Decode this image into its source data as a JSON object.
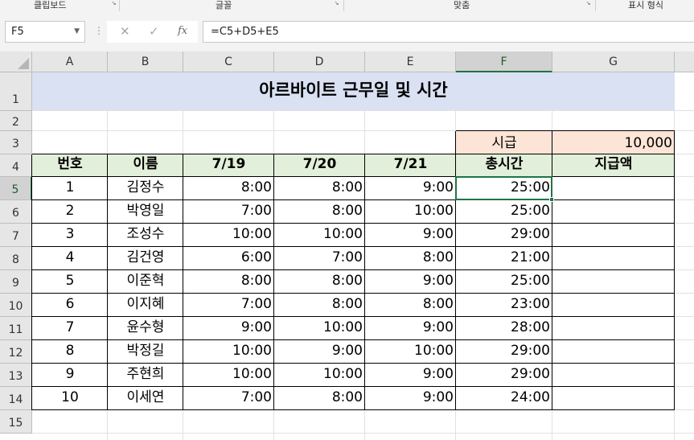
{
  "ribbon_groups": [
    "클립보드",
    "글꼴",
    "맞춤",
    "표시 형식"
  ],
  "name_box": "F5",
  "formula": "=C5+D5+E5",
  "formula_buttons": {
    "cancel": "✕",
    "enter": "✓",
    "function": "fx"
  },
  "columns": [
    "A",
    "B",
    "C",
    "D",
    "E",
    "F",
    "G"
  ],
  "rows": [
    "1",
    "2",
    "3",
    "4",
    "5",
    "6",
    "7",
    "8",
    "9",
    "10",
    "11",
    "12",
    "13",
    "14",
    "15"
  ],
  "title": "아르바이트 근무일 및 시간",
  "wage": {
    "label": "시급",
    "value": "10,000"
  },
  "table_headers": [
    "번호",
    "이름",
    "7/19",
    "7/20",
    "7/21",
    "총시간",
    "지급액"
  ],
  "table_rows": [
    [
      "1",
      "김정수",
      "8:00",
      "8:00",
      "9:00",
      "25:00",
      ""
    ],
    [
      "2",
      "박영일",
      "7:00",
      "8:00",
      "10:00",
      "25:00",
      ""
    ],
    [
      "3",
      "조성수",
      "10:00",
      "10:00",
      "9:00",
      "29:00",
      ""
    ],
    [
      "4",
      "김건영",
      "6:00",
      "7:00",
      "8:00",
      "21:00",
      ""
    ],
    [
      "5",
      "이준혁",
      "8:00",
      "8:00",
      "9:00",
      "25:00",
      ""
    ],
    [
      "6",
      "이지혜",
      "7:00",
      "8:00",
      "8:00",
      "23:00",
      ""
    ],
    [
      "7",
      "윤수형",
      "9:00",
      "10:00",
      "9:00",
      "28:00",
      ""
    ],
    [
      "8",
      "박정길",
      "10:00",
      "9:00",
      "10:00",
      "29:00",
      ""
    ],
    [
      "9",
      "주현희",
      "10:00",
      "10:00",
      "9:00",
      "29:00",
      ""
    ],
    [
      "10",
      "이세연",
      "7:00",
      "8:00",
      "9:00",
      "24:00",
      ""
    ]
  ],
  "active_cell": "F5"
}
